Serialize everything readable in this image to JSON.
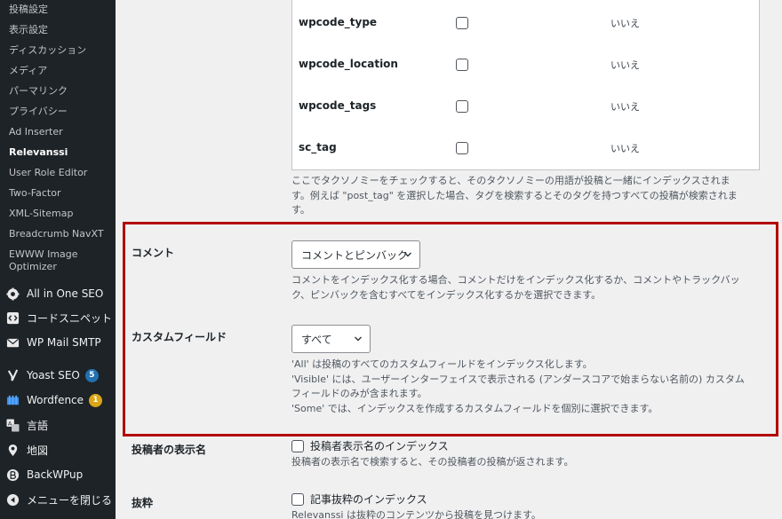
{
  "sidebar": {
    "submenu": [
      {
        "label": "投稿設定",
        "current": false
      },
      {
        "label": "表示設定",
        "current": false
      },
      {
        "label": "ディスカッション",
        "current": false
      },
      {
        "label": "メディア",
        "current": false
      },
      {
        "label": "パーマリンク",
        "current": false
      },
      {
        "label": "プライバシー",
        "current": false
      },
      {
        "label": "Ad Inserter",
        "current": false
      },
      {
        "label": "Relevanssi",
        "current": true
      },
      {
        "label": "User Role Editor",
        "current": false
      },
      {
        "label": "Two-Factor",
        "current": false
      },
      {
        "label": "XML-Sitemap",
        "current": false
      },
      {
        "label": "Breadcrumb NavXT",
        "current": false
      },
      {
        "label": "EWWW Image Optimizer",
        "current": false
      }
    ],
    "menu": [
      {
        "label": "All in One SEO",
        "icon": "aioseo-icon"
      },
      {
        "label": "コードスニペット",
        "icon": "code-icon"
      },
      {
        "label": "WP Mail SMTP",
        "icon": "mail-icon"
      },
      {
        "label": "Yoast SEO",
        "icon": "yoast-icon",
        "badge": "5",
        "badge_color": "#2271b1"
      },
      {
        "label": "Wordfence",
        "icon": "wordfence-icon",
        "badge": "1",
        "badge_color": "#dba617"
      },
      {
        "label": "言語",
        "icon": "translate-icon"
      },
      {
        "label": "地図",
        "icon": "map-pin-icon"
      },
      {
        "label": "BackWPup",
        "icon": "backwpup-icon"
      },
      {
        "label": "メニューを閉じる",
        "icon": "collapse-icon"
      }
    ]
  },
  "taxonomies": {
    "rows": [
      {
        "name": "wpcode_type",
        "value": "いいえ"
      },
      {
        "name": "wpcode_location",
        "value": "いいえ"
      },
      {
        "name": "wpcode_tags",
        "value": "いいえ"
      },
      {
        "name": "sc_tag",
        "value": "いいえ"
      }
    ],
    "description_line1": "ここでタクソノミーをチェックすると、そのタクソノミーの用語が投稿と一緒にインデックスされま",
    "description_line2": "す。例えば \"post_tag\" を選択した場合、タグを検索するとそのタグを持つすべての投稿が検索されま",
    "description_line3": "す。"
  },
  "comments": {
    "label": "コメント",
    "selected": "コメントとピンバック",
    "description_line1": "コメントをインデックス化する場合、コメントだけをインデックス化するか、コメントやトラックバッ",
    "description_line2": "ク、ピンバックを含むすべてをインデックス化するかを選択できます。"
  },
  "custom_fields": {
    "label": "カスタムフィールド",
    "selected": "すべて",
    "description_line1": "'All' は投稿のすべてのカスタムフィールドをインデックス化します。",
    "description_line2": "'Visible' には、ユーザーインターフェイスで表示される (アンダースコアで始まらない名前の) カスタム",
    "description_line3": "フィールドのみが含まれます。",
    "description_line4": "'Some' では、インデックスを作成するカスタムフィールドを個別に選択できます。"
  },
  "author": {
    "label": "投稿者の表示名",
    "checkbox_label": "投稿者表示名のインデックス",
    "description": "投稿者の表示名で検索すると、その投稿者の投稿が返されます。"
  },
  "excerpt": {
    "label": "抜粋",
    "checkbox_label": "記事抜粋のインデックス",
    "description": "Relevanssi は抜粋のコンテンツから投稿を見つけます。"
  },
  "colors": {
    "highlight": "#b30000",
    "sidebar_bg": "#1d2327"
  }
}
